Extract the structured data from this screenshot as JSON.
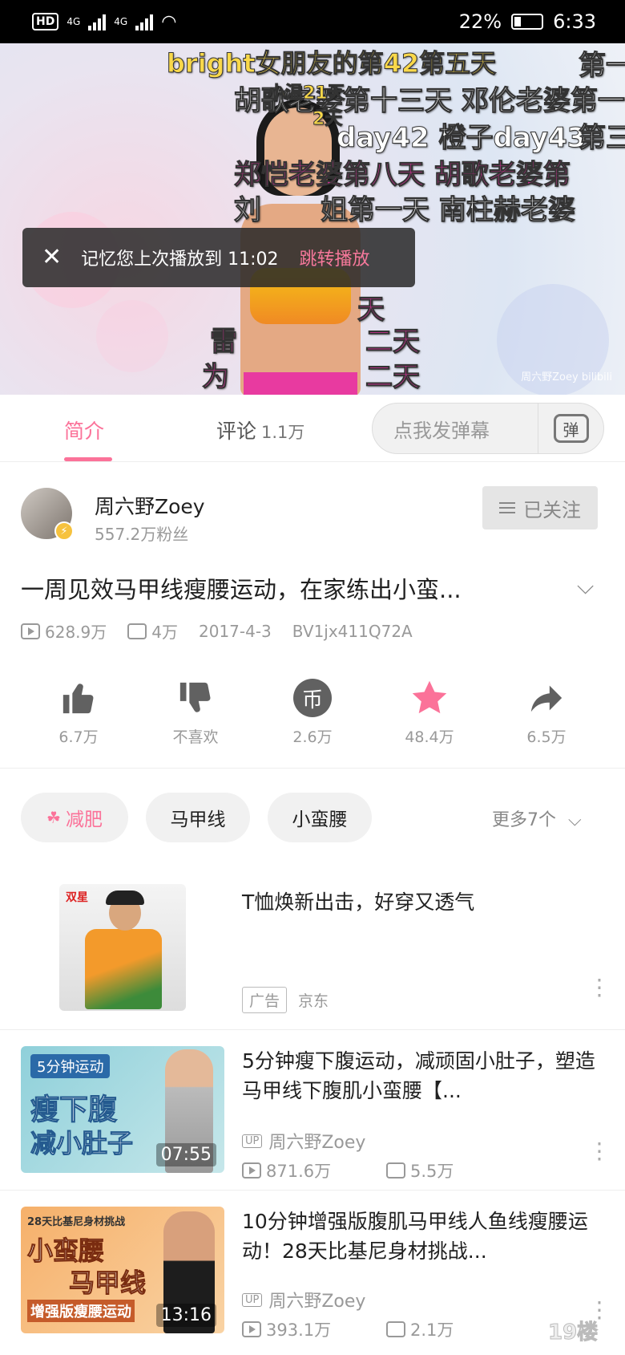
{
  "status_bar": {
    "hd": "HD",
    "sig1": "4G",
    "sig2": "4G",
    "battery": "22%",
    "time": "6:33"
  },
  "video": {
    "danmaku": [
      "bright女朋友的第42第五天",
      "第一",
      "胡歌老婆第十三天 邓伦老婆第一",
      "小温21天",
      "2天",
      "day42 橙子day43",
      "第三",
      "郑恺老婆第八天 胡歌老婆第",
      "刘",
      "姐第一天 南柱赫老婆",
      "天",
      "雷",
      "二天",
      "为",
      "二天"
    ],
    "watermark": "周六野Zoey bilibili",
    "resume": {
      "text": "记忆您上次播放到 11:02",
      "action": "跳转播放"
    }
  },
  "tabs": {
    "intro": "简介",
    "comments": "评论",
    "comments_count": "1.1万",
    "danmu_placeholder": "点我发弹幕",
    "danmu_icon_text": "弹"
  },
  "author": {
    "name": "周六野Zoey",
    "fans": "557.2万粉丝",
    "follow_label": "已关注"
  },
  "video_info": {
    "title": "一周见效马甲线瘦腰运动，在家练出小蛮...",
    "views": "628.9万",
    "danmaku_count": "4万",
    "date": "2017-4-3",
    "bvid": "BV1jx411Q72A"
  },
  "actions": [
    {
      "icon": "thumbs-up-icon",
      "label": "6.7万"
    },
    {
      "icon": "thumbs-down-icon",
      "label": "不喜欢"
    },
    {
      "icon": "coin-icon",
      "label": "2.6万"
    },
    {
      "icon": "star-icon",
      "label": "48.4万"
    },
    {
      "icon": "share-icon",
      "label": "6.5万"
    }
  ],
  "tags": {
    "items": [
      "减肥",
      "马甲线",
      "小蛮腰"
    ],
    "more": "更多7个"
  },
  "recommendations": [
    {
      "title": "T恤焕新出击，好穿又透气",
      "ad_label": "广告",
      "source": "京东",
      "thumb_text": "双星"
    },
    {
      "title": "5分钟瘦下腹运动，减顽固小肚子，塑造马甲线下腹肌小蛮腰【...",
      "up_tag": "UP",
      "uploader": "周六野Zoey",
      "views": "871.6万",
      "danmaku": "5.5万",
      "duration": "07:55",
      "thumb_lines": [
        "5分钟运动",
        "瘦下腹",
        "减小肚子"
      ]
    },
    {
      "title": "10分钟增强版腹肌马甲线人鱼线瘦腰运动！28天比基尼身材挑战...",
      "up_tag": "UP",
      "uploader": "周六野Zoey",
      "views": "393.1万",
      "danmaku": "2.1万",
      "duration": "13:16",
      "thumb_lines": [
        "28天比基尼身材挑战",
        "小蛮腰",
        "马甲线",
        "增强版瘦腰运动"
      ]
    }
  ],
  "corner_watermark": "19楼"
}
